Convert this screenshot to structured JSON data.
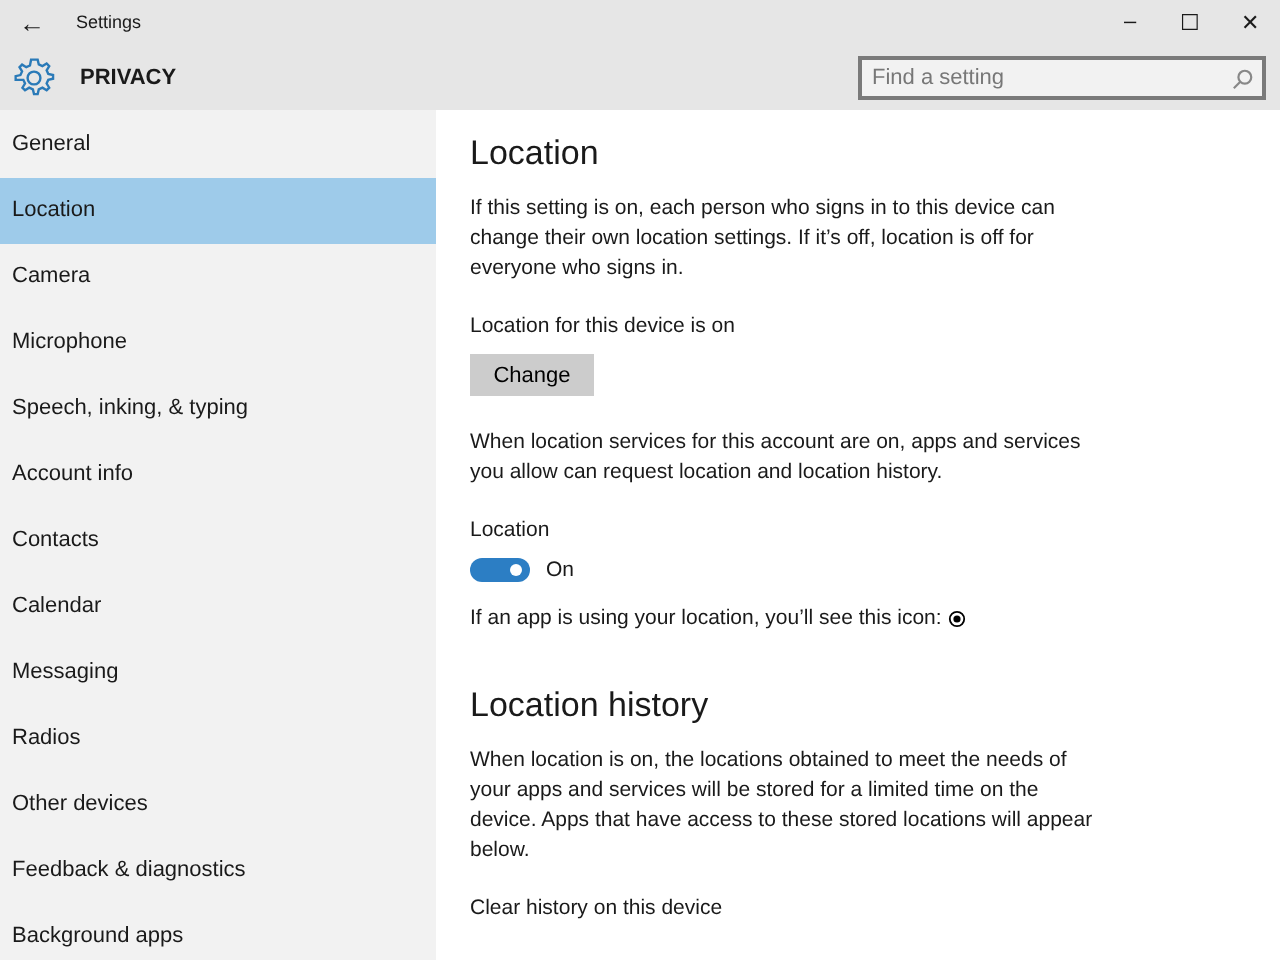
{
  "window": {
    "title": "Settings",
    "back": "←",
    "controls": [
      "–",
      "☐",
      "✕"
    ]
  },
  "header": {
    "title": "PRIVACY",
    "search": {
      "placeholder": "Find a setting"
    }
  },
  "sidebar": {
    "items": [
      {
        "label": "General",
        "selected": false
      },
      {
        "label": "Location",
        "selected": true
      },
      {
        "label": "Camera",
        "selected": false
      },
      {
        "label": "Microphone",
        "selected": false
      },
      {
        "label": "Speech, inking, & typing",
        "selected": false
      },
      {
        "label": "Account info",
        "selected": false
      },
      {
        "label": "Contacts",
        "selected": false
      },
      {
        "label": "Calendar",
        "selected": false
      },
      {
        "label": "Messaging",
        "selected": false
      },
      {
        "label": "Radios",
        "selected": false
      },
      {
        "label": "Other devices",
        "selected": false
      },
      {
        "label": "Feedback & diagnostics",
        "selected": false
      },
      {
        "label": "Background apps",
        "selected": false
      }
    ]
  },
  "content": {
    "heading": "Location",
    "intro": "If this setting is on, each person who signs in to this device can change their own location settings. If it’s off, location is off for everyone who signs in.",
    "device_status": "Location for this device is on",
    "change_button": "Change",
    "account_text": "When location services for this account are on, apps and services you allow can request location and location history.",
    "toggle": {
      "label": "Location",
      "on": true,
      "state_text": "On"
    },
    "icon_note": "If an app is using your location, you’ll see this icon:",
    "history_heading": "Location history",
    "history_text": "When location is on, the locations obtained to meet the needs of your apps and services will be stored for a limited time on the device. Apps that have access to these stored locations will appear below.",
    "clear_label": "Clear history on this device"
  }
}
